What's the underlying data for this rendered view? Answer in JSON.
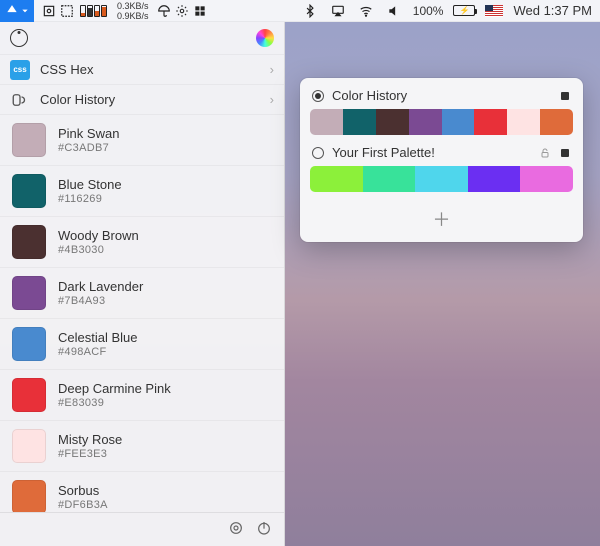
{
  "menubar": {
    "net_up": "0.3KB/s",
    "net_down": "0.9KB/s",
    "battery_pct": "100%",
    "clock": "Wed 1:37 PM"
  },
  "panel": {
    "sections": {
      "css": "CSS Hex",
      "history": "Color History"
    },
    "colors": [
      {
        "name": "Pink Swan",
        "hex": "#C3ADB7"
      },
      {
        "name": "Blue Stone",
        "hex": "#116269"
      },
      {
        "name": "Woody Brown",
        "hex": "#4B3030"
      },
      {
        "name": "Dark Lavender",
        "hex": "#7B4A93"
      },
      {
        "name": "Celestial Blue",
        "hex": "#498ACF"
      },
      {
        "name": "Deep Carmine Pink",
        "hex": "#E83039"
      },
      {
        "name": "Misty Rose",
        "hex": "#FEE3E3"
      },
      {
        "name": "Sorbus",
        "hex": "#DF6B3A"
      }
    ]
  },
  "palette_panel": {
    "history_title": "Color History",
    "history_colors": [
      "#C3ADB7",
      "#116269",
      "#4B3030",
      "#7B4A93",
      "#498ACF",
      "#E83039",
      "#FEE3E3",
      "#DF6B3A"
    ],
    "first_palette_title": "Your First Palette!",
    "first_palette_colors": [
      "#8CF03A",
      "#38E29A",
      "#4FD6EC",
      "#6B2FF2",
      "#E96BE0"
    ]
  }
}
